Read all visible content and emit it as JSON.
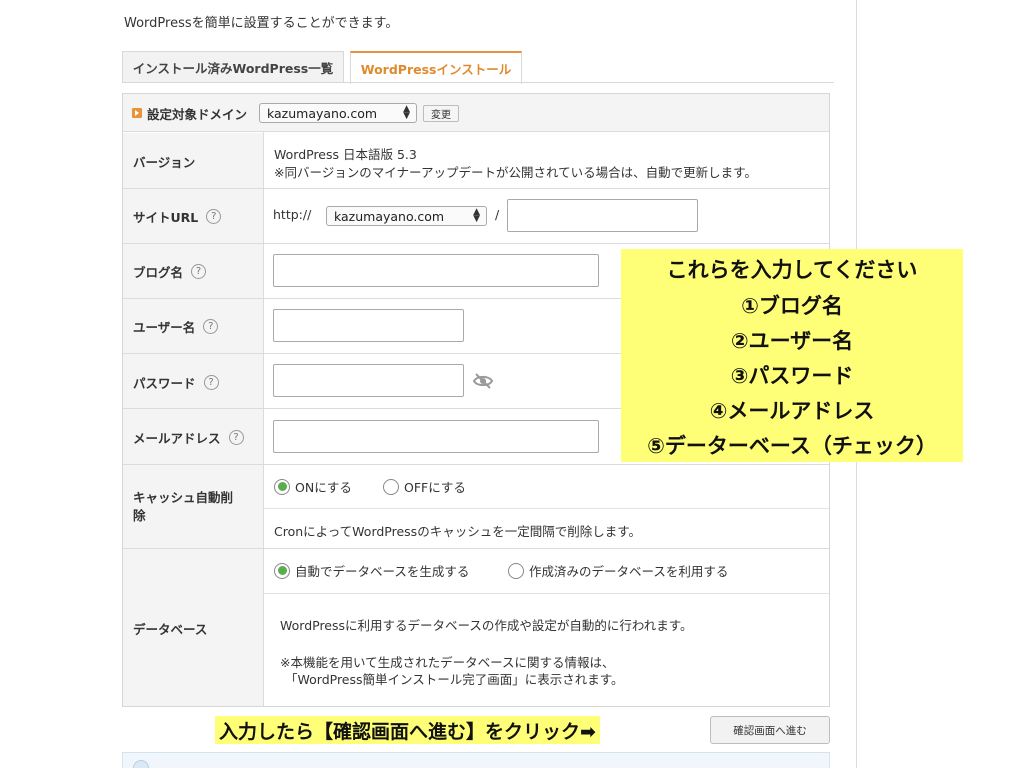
{
  "intro": "WordPressを簡単に設置することができます。",
  "tabs": {
    "installed": "インストール済みWordPress一覧",
    "install": "WordPressインストール"
  },
  "domain": {
    "label": "設定対象ドメイン",
    "value": "kazumayano.com",
    "change": "変更"
  },
  "version": {
    "label": "バージョン",
    "line1": "WordPress 日本語版 5.3",
    "line2": "※同バージョンのマイナーアップデートが公開されている場合は、自動で更新します。"
  },
  "site_url": {
    "label": "サイトURL",
    "prefix": "http://",
    "domain": "kazumayano.com",
    "slash": "/",
    "path": ""
  },
  "blog_name": {
    "label": "ブログ名",
    "value": ""
  },
  "user_name": {
    "label": "ユーザー名",
    "value": ""
  },
  "password": {
    "label": "パスワード",
    "value": ""
  },
  "email": {
    "label": "メールアドレス",
    "value": ""
  },
  "cache": {
    "label": "キャッシュ自動削除",
    "on": "ONにする",
    "off": "OFFにする",
    "desc": "CronによってWordPressのキャッシュを一定間隔で削除します。"
  },
  "database": {
    "label": "データベース",
    "auto": "自動でデータベースを生成する",
    "existing": "作成済みのデータベースを利用する",
    "desc1": "WordPressに利用するデータベースの作成や設定が自動的に行われます。",
    "desc2": "※本機能を用いて生成されたデータベースに関する情報は、",
    "desc3": "「WordPress簡単インストール完了画面」に表示されます。"
  },
  "help_glyph": "?",
  "annotation": {
    "lines": [
      "これらを入力してください",
      "①ブログ名",
      "②ユーザー名",
      "③パスワード",
      "④メールアドレス",
      "⑤データーベース（チェック）"
    ],
    "cta": "入力したら【確認画面へ進む】をクリック➡"
  },
  "confirm_button": "確認画面へ進む",
  "colors": {
    "accent": "#e8933a",
    "radio_on": "#5aac4f",
    "highlight": "#ffff77"
  }
}
